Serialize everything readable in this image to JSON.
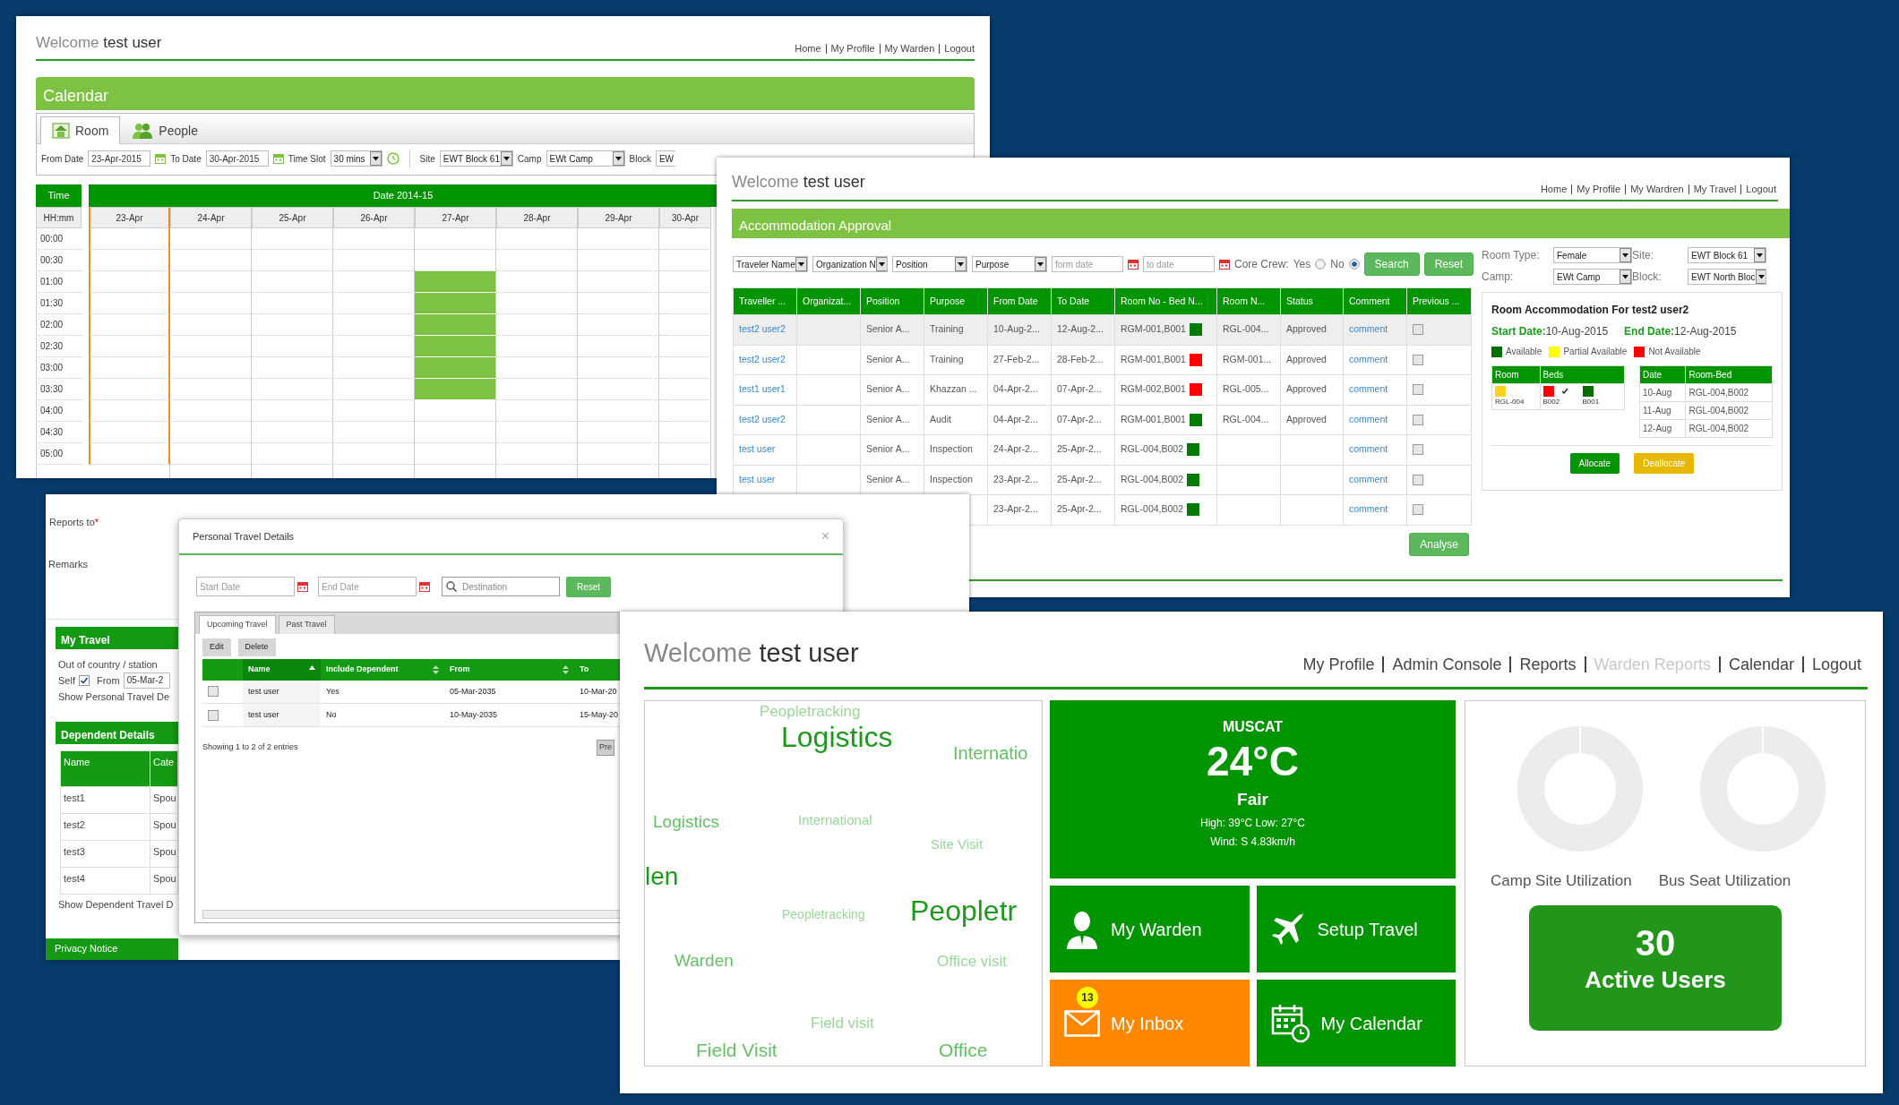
{
  "calendar_screen": {
    "welcome": {
      "greeting": "Welcome",
      "user": "test user"
    },
    "nav_links": [
      "Home",
      "My Profile",
      "My Warden",
      "Logout"
    ],
    "title": "Calendar",
    "tabs": [
      {
        "label": "Room",
        "kind": "room",
        "selected": true
      },
      {
        "label": "People",
        "kind": "people",
        "selected": false
      }
    ],
    "filters": [
      {
        "kind": "date",
        "label": "From Date",
        "value": "23-Apr-2015"
      },
      {
        "kind": "date",
        "label": "To Date",
        "value": "30-Apr-2015"
      },
      {
        "kind": "time_select",
        "label": "Time Slot",
        "value": "30 mins"
      },
      {
        "kind": "select",
        "label": "Site",
        "value": "EWT Block 61"
      },
      {
        "kind": "select",
        "label": "Camp",
        "value": "EWt Camp"
      },
      {
        "kind": "partial_select",
        "label": "Block",
        "value": "EW"
      }
    ],
    "grid": {
      "time_header": "Time",
      "format_label": "HH:mm",
      "date_header": "Date 2014-15",
      "columns": [
        {
          "label": "23-Apr",
          "today": true
        },
        {
          "label": "24-Apr",
          "today": false
        },
        {
          "label": "25-Apr",
          "today": false
        },
        {
          "label": "26-Apr",
          "today": false
        },
        {
          "label": "27-Apr",
          "today": false
        },
        {
          "label": "28-Apr",
          "today": false
        },
        {
          "label": "29-Apr",
          "today": false
        },
        {
          "label": "30-Apr",
          "today": false
        }
      ],
      "rows": [
        {
          "time": "00:00",
          "booked": [
            false,
            false,
            false,
            false,
            false,
            false,
            false,
            false
          ]
        },
        {
          "time": "00:30",
          "booked": [
            false,
            false,
            false,
            false,
            false,
            false,
            false,
            false
          ]
        },
        {
          "time": "01:00",
          "booked": [
            false,
            false,
            false,
            false,
            true,
            false,
            false,
            false
          ]
        },
        {
          "time": "01:30",
          "booked": [
            false,
            false,
            false,
            false,
            true,
            false,
            false,
            false
          ]
        },
        {
          "time": "02:00",
          "booked": [
            false,
            false,
            false,
            false,
            true,
            false,
            false,
            false
          ]
        },
        {
          "time": "02:30",
          "booked": [
            false,
            false,
            false,
            false,
            true,
            false,
            false,
            false
          ]
        },
        {
          "time": "03:00",
          "booked": [
            false,
            false,
            false,
            false,
            true,
            false,
            false,
            false
          ]
        },
        {
          "time": "03:30",
          "booked": [
            false,
            false,
            false,
            false,
            true,
            false,
            false,
            false
          ]
        },
        {
          "time": "04:00",
          "booked": [
            false,
            false,
            false,
            false,
            false,
            false,
            false,
            false
          ]
        },
        {
          "time": "04:30",
          "booked": [
            false,
            false,
            false,
            false,
            false,
            false,
            false,
            false
          ]
        },
        {
          "time": "05:00",
          "booked": [
            false,
            false,
            false,
            false,
            false,
            false,
            false,
            false
          ]
        }
      ]
    }
  },
  "approval_screen": {
    "welcome": {
      "greeting": "Welcome",
      "user": "test user"
    },
    "nav_links": [
      "Home",
      "My Profile",
      "My Wardren",
      "My Travel",
      "Logout"
    ],
    "title": "Accommodation Approval",
    "filter_selects": [
      "Traveler Name",
      "Organization N",
      "Position",
      "Purpose"
    ],
    "date_inputs": [
      {
        "placeholder": "form date"
      },
      {
        "placeholder": "to date"
      }
    ],
    "core_crew": {
      "label": "Core Crew:",
      "options": [
        {
          "label": "Yes",
          "selected": false
        },
        {
          "label": "No",
          "selected": true
        }
      ]
    },
    "buttons": [
      "Search",
      "Reset"
    ],
    "columns": [
      "Traveller ...",
      "Organizat...",
      "Position",
      "Purpose",
      "From Date",
      "To Date",
      "Room No - Bed N...",
      "Room N...",
      "Status",
      "Comment",
      "Previous ..."
    ],
    "rows": [
      {
        "selected": true,
        "traveller": "test2 user2",
        "position": "Senior A...",
        "purpose": "Training",
        "from": "10-Aug-2...",
        "to": "12-Aug-2...",
        "room_bed": "RGM-001,B001",
        "color": "#007a00",
        "room": "RGL-004...",
        "status": "Approved",
        "comment": "comment",
        "previous_checked": false
      },
      {
        "selected": false,
        "traveller": "test2 user2",
        "position": "Senior A...",
        "purpose": "Training",
        "from": "27-Feb-2...",
        "to": "28-Feb-2...",
        "room_bed": "RGM-001,B001",
        "color": "#ff0000",
        "room": "RGM-001...",
        "status": "Approved",
        "comment": "comment",
        "previous_checked": false
      },
      {
        "selected": false,
        "traveller": "test1 user1",
        "position": "Senior A...",
        "purpose": "Khazzan ...",
        "from": "04-Apr-2...",
        "to": "07-Apr-2...",
        "room_bed": "RGM-002,B001",
        "color": "#ff0000",
        "room": "RGL-005...",
        "status": "Approved",
        "comment": "comment",
        "previous_checked": false
      },
      {
        "selected": false,
        "traveller": "test2 user2",
        "position": "Senior A...",
        "purpose": "Audit",
        "from": "04-Apr-2...",
        "to": "07-Apr-2...",
        "room_bed": "RGM-001,B001",
        "color": "#007a00",
        "room": "RGL-004...",
        "status": "Approved",
        "comment": "comment",
        "previous_checked": false
      },
      {
        "selected": false,
        "traveller": "test user",
        "position": "Senior A...",
        "purpose": "Inspection",
        "from": "24-Apr-2...",
        "to": "25-Apr-2...",
        "room_bed": "RGL-004,B002",
        "color": "#007a00",
        "comment": "comment",
        "previous_checked": false
      },
      {
        "selected": false,
        "traveller": "test user",
        "position": "Senior A...",
        "purpose": "Inspection",
        "from": "23-Apr-2...",
        "to": "25-Apr-2...",
        "room_bed": "RGL-004,B002",
        "color": "#007a00",
        "comment": "comment",
        "previous_checked": false
      },
      {
        "selected": false,
        "from": "23-Apr-2...",
        "to": "25-Apr-2...",
        "room_bed": "RGL-004,B002",
        "color": "#007a00",
        "comment": "comment",
        "previous_checked": false
      }
    ],
    "analyse_button": "Analyse",
    "room_filters": [
      {
        "label": "Room Type:",
        "value": "Female"
      },
      {
        "label": "Site:",
        "value": "EWT Block 61"
      },
      {
        "label": "Camp:",
        "value": "EWt Camp"
      },
      {
        "label": "Block:",
        "value": "EWT North Bloc"
      }
    ],
    "detail": {
      "title": "Room Accommodation For test2 user2",
      "start_label": "Start Date:",
      "start_value": "10-Aug-2015",
      "end_label": "End Date:",
      "end_value": "12-Aug-2015",
      "legend": [
        {
          "label": "Available",
          "color": "#006e00"
        },
        {
          "label": "Partial Available",
          "color": "#ffff00"
        },
        {
          "label": "Not Available",
          "color": "#ff0000"
        }
      ],
      "room_columns": [
        "Room",
        "Beds"
      ],
      "room": {
        "label": "RGL-004",
        "color": "#ffd21e"
      },
      "beds": [
        {
          "label": "B002",
          "color": "#ff0000",
          "checked": true
        },
        {
          "label": "B001",
          "color": "#006e00",
          "checked": false
        }
      ],
      "date_columns": [
        "Date",
        "Room-Bed"
      ],
      "date_rows": [
        [
          "10-Aug",
          "RGL-004,B002"
        ],
        [
          "11-Aug",
          "RGL-004,B002"
        ],
        [
          "12-Aug",
          "RGL-004,B002"
        ]
      ],
      "buttons": [
        {
          "label": "Allocate",
          "kind": "primary"
        },
        {
          "label": "Deallocate",
          "kind": "warning"
        }
      ]
    }
  },
  "travel_screen": {
    "reports_label": "Reports to",
    "required_mark": "*",
    "remarks_label": "Remarks",
    "my_travel": {
      "title": "My Travel",
      "out_label": "Out of country / station",
      "self_label": "Self",
      "self_checked": true,
      "from_label": "From",
      "from_value": "05-Mar-2",
      "link": "Show Personal Travel De"
    },
    "dependents": {
      "title": "Dependent Details",
      "columns": [
        "Name",
        "Cate"
      ],
      "rows": [
        [
          "test1",
          "Spou"
        ],
        [
          "test2",
          "Spou"
        ],
        [
          "test3",
          "Spou"
        ],
        [
          "test4",
          "Spou"
        ]
      ],
      "link": "Show Dependent Travel D"
    },
    "privacy": "Privacy Notice",
    "modal": {
      "title": "Personal Travel Details",
      "close": "×",
      "start_placeholder": "Start Date",
      "end_placeholder": "End Date",
      "destination_placeholder": "Destination",
      "reset": "Reset",
      "tabs": [
        {
          "label": "Upcoming Travel",
          "selected": true
        },
        {
          "label": "Past Travel",
          "selected": false
        }
      ],
      "actions": [
        "Edit",
        "Delete"
      ],
      "columns": [
        {
          "label": "Name",
          "sortable": true,
          "sorted": true
        },
        {
          "label": "Include Dependent",
          "sortable": true,
          "sorted": false
        },
        {
          "label": "From",
          "sortable": true,
          "sorted": false
        },
        {
          "label": "To"
        }
      ],
      "rows": [
        {
          "checked": false,
          "cells": [
            "test user",
            "Yes",
            "05-Mar-2035",
            "10-Mar-20"
          ]
        },
        {
          "checked": false,
          "cells": [
            "test user",
            "No",
            "10-May-2035",
            "15-May-20"
          ]
        }
      ],
      "info": "Showing 1 to 2 of 2 entries",
      "pager": "Pre"
    }
  },
  "dashboard": {
    "welcome": {
      "greeting": "Welcome",
      "user": "test user"
    },
    "nav_links": [
      {
        "label": "My Profile",
        "disabled": false
      },
      {
        "label": "Admin Console",
        "disabled": false
      },
      {
        "label": "Reports",
        "disabled": false
      },
      {
        "label": "Warden Reports",
        "disabled": true
      },
      {
        "label": "Calendar",
        "disabled": false
      },
      {
        "label": "Logout",
        "disabled": false
      }
    ],
    "word_cloud": [
      {
        "text": "Peopletracking",
        "kind": "small"
      },
      {
        "text": "Logistics",
        "kind": "big"
      },
      {
        "text": "Internatio",
        "kind": "medium"
      },
      {
        "text": "Logistics",
        "kind": "medium"
      },
      {
        "text": "International",
        "kind": "small"
      },
      {
        "text": "Site Visit",
        "kind": "small"
      },
      {
        "text": "len",
        "kind": "big"
      },
      {
        "text": "Peopletracking",
        "kind": "small"
      },
      {
        "text": "Peopletr",
        "kind": "big"
      },
      {
        "text": "Warden",
        "kind": "medium"
      },
      {
        "text": "Office visit",
        "kind": "small"
      },
      {
        "text": "Field visit",
        "kind": "small"
      },
      {
        "text": "Field Visit",
        "kind": "medium"
      },
      {
        "text": "Office",
        "kind": "medium"
      }
    ],
    "weather": {
      "city": "MUSCAT",
      "temperature": "24°C",
      "condition": "Fair",
      "high_low": "High: 39°C Low: 27°C",
      "wind": "Wind: S 4.83km/h"
    },
    "tiles": [
      {
        "label": "My Warden",
        "kind": "warden",
        "color": "#009400"
      },
      {
        "label": "Setup Travel",
        "kind": "travel",
        "color": "#009400"
      },
      {
        "label": "My Inbox",
        "kind": "inbox",
        "color": "#ff8800",
        "badge": "13"
      },
      {
        "label": "My Calendar",
        "kind": "calendar",
        "color": "#009400"
      }
    ],
    "utilization": [
      {
        "label": "Camp Site Utilization"
      },
      {
        "label": "Bus Seat Utilization"
      }
    ],
    "active_users": {
      "count": "30",
      "label": "Active Users"
    }
  }
}
